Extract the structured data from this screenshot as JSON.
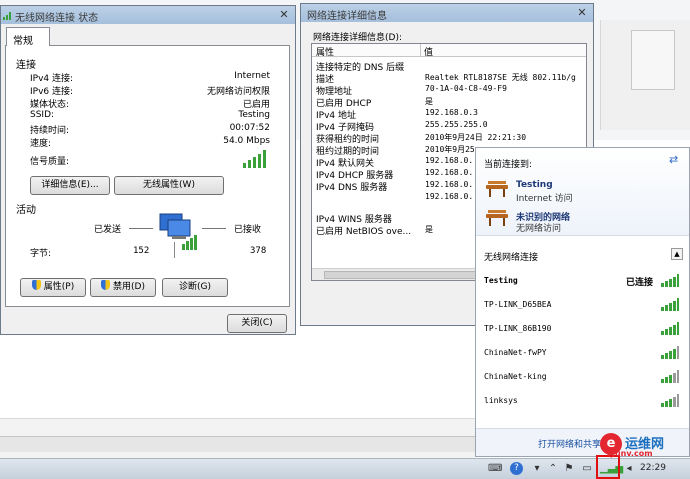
{
  "status_window": {
    "title": "无线网络连接 状态",
    "close": "✕",
    "tab": "常规",
    "connection_group": "连接",
    "rows": [
      {
        "label": "IPv4 连接:",
        "value": "Internet"
      },
      {
        "label": "IPv6 连接:",
        "value": "无网络访问权限"
      },
      {
        "label": "媒体状态:",
        "value": "已启用"
      },
      {
        "label": "SSID:",
        "value": "Testing"
      },
      {
        "label": "持续时间:",
        "value": "00:07:52"
      },
      {
        "label": "速度:",
        "value": "54.0 Mbps"
      }
    ],
    "signal_label": "信号质量:",
    "details_button": "详细信息(E)...",
    "wireless_props_button": "无线属性(W)",
    "activity_group": "活动",
    "sent_label": "已发送",
    "received_label": "已接收",
    "bytes_label": "字节:",
    "bytes_sent": "152",
    "bytes_received": "378",
    "properties_button": "属性(P)",
    "disable_button": "禁用(D)",
    "diagnose_button": "诊断(G)",
    "close_button": "关闭(C)"
  },
  "details_window": {
    "title": "网络连接详细信息",
    "close": "✕",
    "heading": "网络连接详细信息(D):",
    "col_property": "属性",
    "col_value": "值",
    "rows": [
      {
        "k": "连接特定的 DNS 后缀",
        "v": ""
      },
      {
        "k": "描述",
        "v": "Realtek RTL8187SE 无线 802.11b/g"
      },
      {
        "k": "物理地址",
        "v": "70-1A-04-C8-49-F9"
      },
      {
        "k": "已启用 DHCP",
        "v": "是"
      },
      {
        "k": "IPv4 地址",
        "v": "192.168.0.3"
      },
      {
        "k": "IPv4 子网掩码",
        "v": "255.255.255.0"
      },
      {
        "k": "获得租约的时间",
        "v": "2010年9月24日 22:21:30"
      },
      {
        "k": "租约过期的时间",
        "v": "2010年9月25"
      },
      {
        "k": "IPv4 默认网关",
        "v": "192.168.0."
      },
      {
        "k": "IPv4 DHCP 服务器",
        "v": "192.168.0."
      },
      {
        "k": "IPv4 DNS 服务器",
        "v": "192.168.0."
      },
      {
        "k": "",
        "v": "192.168.0."
      },
      {
        "k": "IPv4 WINS 服务器",
        "v": ""
      },
      {
        "k": "已启用 NetBIOS ove...",
        "v": "是"
      }
    ]
  },
  "flyout": {
    "connected_to": "当前连接到:",
    "net1_name": "Testing",
    "net1_sub": "Internet 访问",
    "net2_name": "未识别的网络",
    "net2_sub": "无网络访问",
    "wireless_header": "无线网络连接",
    "networks": [
      {
        "name": "Testing",
        "status": "已连接"
      },
      {
        "name": "TP-LINK_D65BEA",
        "status": ""
      },
      {
        "name": "TP-LINK_86B190",
        "status": ""
      },
      {
        "name": "ChinaNet-fwPY",
        "status": ""
      },
      {
        "name": "ChinaNet-king",
        "status": ""
      },
      {
        "name": "linksys",
        "status": ""
      }
    ],
    "footer_link": "打开网络和共享中心"
  },
  "taskbar": {
    "clock": "22:29"
  },
  "watermark": {
    "cn": "运维网",
    "en": "iyunv.com",
    "logo": "e"
  }
}
